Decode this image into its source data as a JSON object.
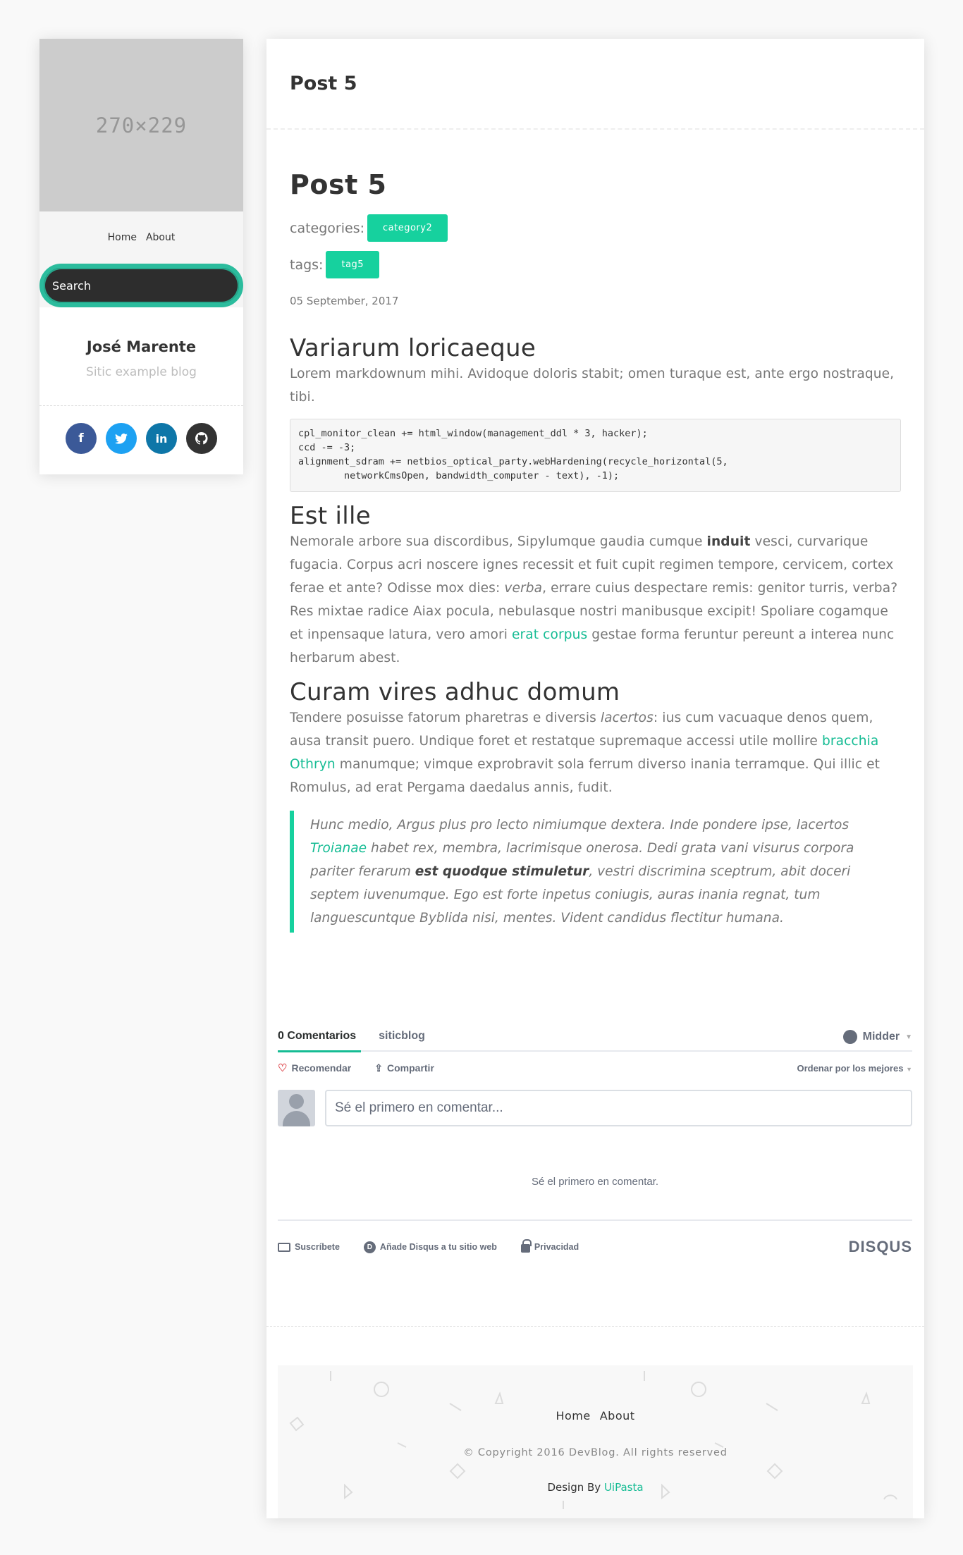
{
  "sidebar": {
    "avatar_placeholder": "270×229",
    "nav": [
      "Home",
      "About"
    ],
    "search_placeholder": "Search",
    "name": "José Marente",
    "description": "Sitic example blog",
    "social": [
      {
        "name": "facebook",
        "glyph": "f",
        "color": "#3b5998"
      },
      {
        "name": "twitter",
        "glyph": "t",
        "color": "#1da1f2"
      },
      {
        "name": "linkedin",
        "glyph": "in",
        "color": "#0e76a8"
      },
      {
        "name": "github",
        "glyph": "gh",
        "color": "#333333"
      }
    ]
  },
  "header": {
    "title": "Post 5"
  },
  "post": {
    "title": "Post 5",
    "categories_label": "categories:",
    "category": "category2",
    "tags_label": "tags:",
    "tag": "tag5",
    "date": "05 September, 2017",
    "section1": {
      "heading": "Variarum loricaeque",
      "text": "Lorem markdownum mihi. Avidoque doloris stabit; omen turaque est, ante ergo nostraque, tibi.",
      "code": "cpl_monitor_clean += html_window(management_ddl * 3, hacker);\nccd -= -3;\nalignment_sdram += netbios_optical_party.webHardening(recycle_horizontal(5,\n        networkCmsOpen, bandwidth_computer - text), -1);"
    },
    "section2": {
      "heading": "Est ille",
      "t1": "Nemorale arbore sua discordibus, Sipylumque gaudia cumque ",
      "b1": "induit",
      "t2": " vesci, curvarique fugacia. Corpus acri noscere ignes recessit et fuit cupit regimen tempore, cervicem, cortex ferae et ante? Odisse mox dies: ",
      "i1": "verba",
      "t3": ", errare cuius despectare remis: genitor turris, verba? Res mixtae radice Aiax pocula, nebulasque nostri manibusque excipit! Spoliare cogamque et inpensaque latura, vero amori ",
      "link": "erat corpus",
      "t4": " gestae forma feruntur pereunt a interea nunc herbarum abest."
    },
    "section3": {
      "heading": "Curam vires adhuc domum",
      "t1": "Tendere posuisse fatorum pharetras e diversis ",
      "i1": "lacertos",
      "t2": ": ius cum vacuaque denos quem, ausa transit puero. Undique foret et restatque supremaque accessi utile mollire ",
      "link": "bracchia Othryn",
      "t3": " manumque; vimque exprobravit sola ferrum diverso inania terramque. Qui illic et Romulus, ad erat Pergama daedalus annis, fudit."
    },
    "quote": {
      "t1": "Hunc medio, Argus plus pro lecto nimiumque dextera. Inde pondere ipse, lacertos ",
      "link": "Troianae",
      "t2": " habet rex, membra, lacrimisque onerosa. Dedi grata vani visurus corpora pariter ferarum ",
      "b1": "est quodque stimuletur",
      "t3": ", vestri discrimina sceptrum, abit doceri septem iuvenumque. Ego est forte inpetus coniugis, auras inania regnat, tum languescuntque Byblida nisi, mentes. Vident candidus flectitur humana."
    }
  },
  "disqus": {
    "tab_comments": "0 Comentarios",
    "tab_site": "siticblog",
    "user": "Midder",
    "recommend": "Recomendar",
    "share": "Compartir",
    "sort": "Ordenar por los mejores",
    "input_placeholder": "Sé el primero en comentar...",
    "empty": "Sé el primero en comentar.",
    "subscribe": "Suscríbete",
    "add_disqus": "Añade Disqus a tu sitio web",
    "privacy": "Privacidad",
    "logo": "DISQUS"
  },
  "footer": {
    "nav": [
      "Home",
      "About"
    ],
    "copyright": "© Copyright 2016 DevBlog. All rights reserved",
    "design_by": "Design By",
    "design_link": "UiPasta"
  },
  "colors": {
    "accent": "#16d19e",
    "link": "#16bc94",
    "search_ring": "#2bbc9d"
  }
}
